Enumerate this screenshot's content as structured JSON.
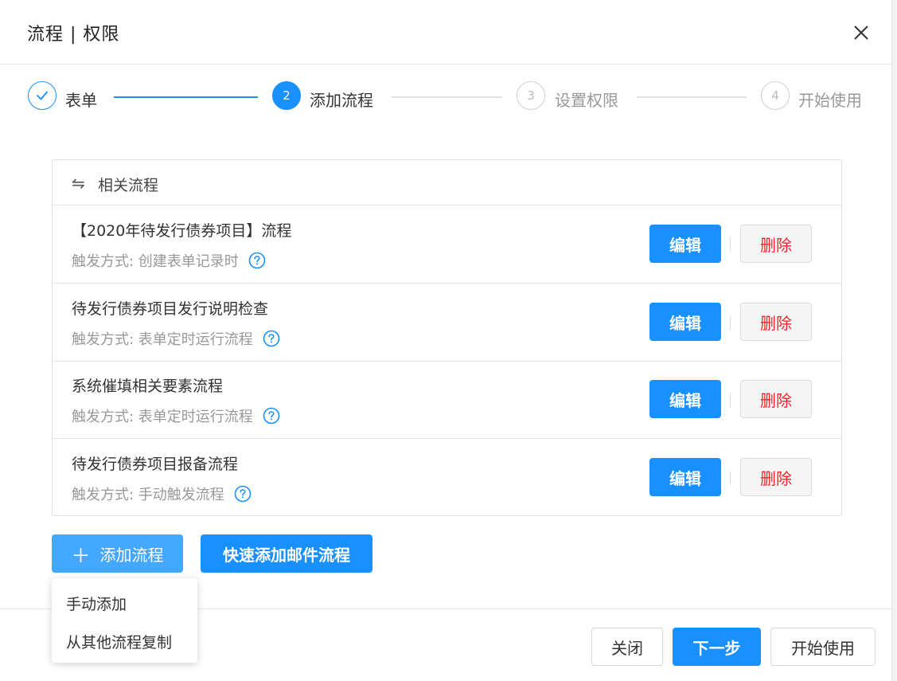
{
  "dialog": {
    "title": "流程 | 权限"
  },
  "steps": [
    {
      "label": "表单",
      "number": "",
      "status": "done",
      "icon": "check-icon"
    },
    {
      "label": "添加流程",
      "number": "2",
      "status": "active"
    },
    {
      "label": "设置权限",
      "number": "3",
      "status": "todo"
    },
    {
      "label": "开始使用",
      "number": "4",
      "status": "todo"
    }
  ],
  "panel": {
    "header_icon": "swap-arrows-icon",
    "header": "相关流程",
    "edit_label": "编辑",
    "delete_label": "删除",
    "flows": [
      {
        "name": "【2020年待发行债券项目】流程",
        "trigger": "触发方式: 创建表单记录时"
      },
      {
        "name": "待发行债券项目发行说明检查",
        "trigger": "触发方式: 表单定时运行流程"
      },
      {
        "name": "系统催填相关要素流程",
        "trigger": "触发方式: 表单定时运行流程"
      },
      {
        "name": "待发行债券项目报备流程",
        "trigger": "触发方式: 手动触发流程"
      }
    ]
  },
  "actions": {
    "add_icon": "plus-icon",
    "add_flow": "添加流程",
    "quick_add_mail": "快速添加邮件流程"
  },
  "dropdown": {
    "items": [
      "手动添加",
      "从其他流程复制"
    ]
  },
  "footer": {
    "close": "关闭",
    "next": "下一步",
    "start": "开始使用"
  },
  "colors": {
    "primary": "#1890ff",
    "primary_light": "#45a8ff",
    "danger": "#f5222d",
    "muted": "#999999"
  }
}
